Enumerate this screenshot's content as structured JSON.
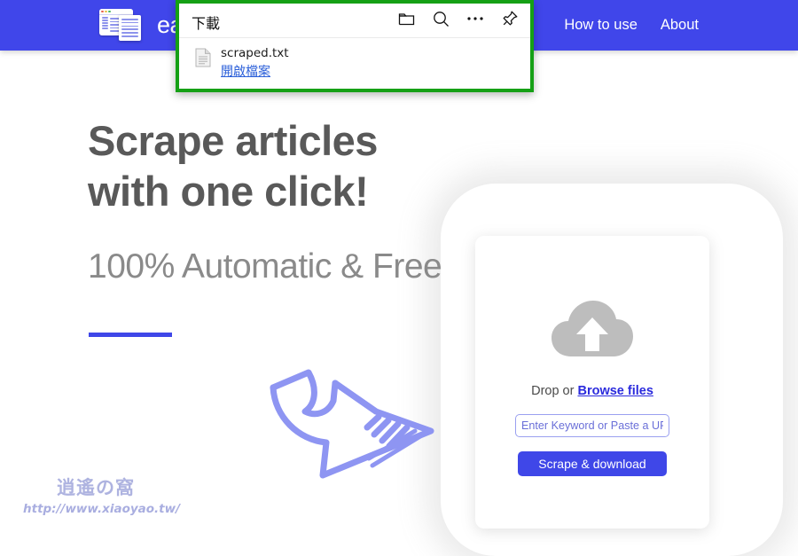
{
  "site": {
    "header": {
      "logo_icon": "documents-logo-icon",
      "logo_text": "ea",
      "background_color": "#4046ea",
      "nav": [
        {
          "label": "How to use"
        },
        {
          "label": "About"
        }
      ]
    },
    "hero": {
      "heading": "Scrape articles with one click!",
      "subheading": "100% Automatic & Free",
      "underline_color": "#3f47e8"
    },
    "card": {
      "upload_icon": "cloud-upload-icon",
      "drop_text": "Drop or ",
      "browse_link": "Browse files",
      "input_placeholder": "Enter Keyword or Paste a URL",
      "input_value": "",
      "submit_label": "Scrape & download",
      "submit_color": "#3f47e8"
    },
    "annotation": {
      "arrow_icon": "curved-arrow-icon",
      "arrow_color": "#8e95f2"
    },
    "watermark": {
      "logo_text": "逍遙の窩",
      "url": "http://www.xiaoyao.tw/",
      "color": "#a9aee0"
    }
  },
  "downloads_popup": {
    "title": "下載",
    "highlight_color": "#15a015",
    "actions": [
      {
        "name": "open-folder-icon"
      },
      {
        "name": "search-icon"
      },
      {
        "name": "more-options-icon"
      },
      {
        "name": "pin-icon"
      }
    ],
    "items": [
      {
        "file_icon": "text-file-icon",
        "filename": "scraped.txt",
        "action_label": "開啟檔案"
      }
    ]
  }
}
